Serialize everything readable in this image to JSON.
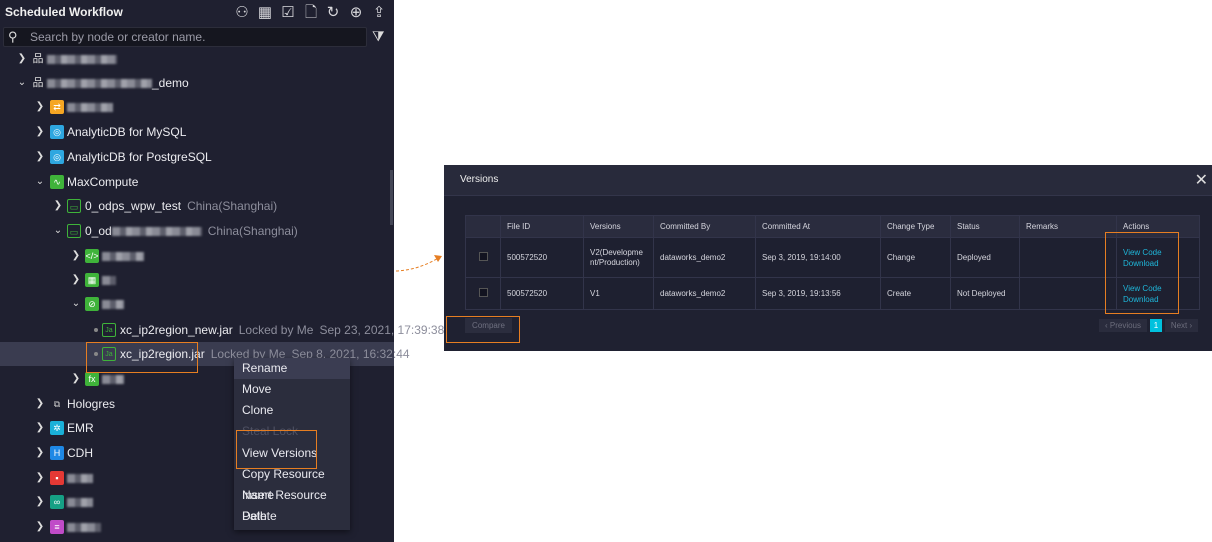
{
  "panel": {
    "title": "Scheduled Workflow",
    "search_placeholder": "Search by node or creator name.",
    "toolbar": [
      "user-list-icon",
      "calendar-search-icon",
      "checklist-icon",
      "new-file-icon",
      "refresh-icon",
      "locate-icon",
      "import-icon"
    ]
  },
  "tree": {
    "demo_suffix": "_demo",
    "adb_mysql": "AnalyticDB for MySQL",
    "adb_pg": "AnalyticDB for PostgreSQL",
    "maxcompute": "MaxCompute",
    "proj1": "0_odps_wpw_test",
    "proj1_region": "China(Shanghai)",
    "proj2": "0_od",
    "proj2_region": "China(Shanghai)",
    "jar1": "xc_ip2region_new.jar",
    "jar1_lock": "Locked by Me",
    "jar1_time": "Sep 23, 2021, 17:39:38",
    "jar2": "xc_ip2region.jar",
    "jar2_lock": "Locked by Me",
    "jar2_time": "Sep 8, 2021, 16:32:44",
    "hologres": "Hologres",
    "emr": "EMR",
    "cdh": "CDH",
    "jar_icon": "Ja"
  },
  "context_menu": [
    "Rename",
    "Move",
    "Clone",
    "Steal Lock",
    "View Versions",
    "Copy Resource Name",
    "Insert Resource Path",
    "Delete"
  ],
  "versions_dialog": {
    "title": "Versions",
    "columns": [
      "File ID",
      "Versions",
      "Committed By",
      "Committed At",
      "Change Type",
      "Status",
      "Remarks",
      "Actions"
    ],
    "rows": [
      {
        "file_id": "500572520",
        "version": "V2(Development/Production)",
        "committed_by": "dataworks_demo2",
        "committed_at": "Sep 3, 2019, 19:14:00",
        "change_type": "Change",
        "status": "Deployed",
        "remarks": "",
        "view": "View Code",
        "download": "Download"
      },
      {
        "file_id": "500572520",
        "version": "V1",
        "committed_by": "dataworks_demo2",
        "committed_at": "Sep 3, 2019, 19:13:56",
        "change_type": "Create",
        "status": "Not Deployed",
        "remarks": "",
        "view": "View Code",
        "download": "Download"
      }
    ],
    "compare": "Compare",
    "prev": "Previous",
    "page": "1",
    "next": "Next"
  },
  "colors": {
    "accent": "#e67e22",
    "link": "#1fb6d9",
    "page_active": "#00c1de"
  }
}
